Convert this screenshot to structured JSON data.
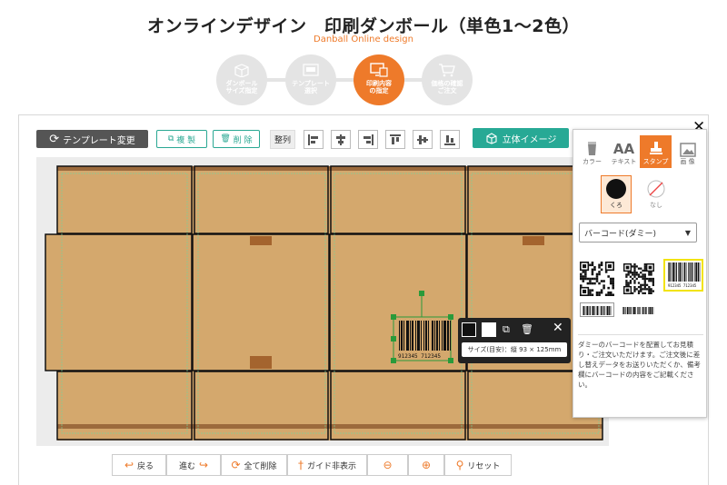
{
  "header": {
    "title": "オンラインデザイン　印刷ダンボール（単色1～2色）",
    "subtitle": "Danball Online design"
  },
  "steps": [
    {
      "label1": "ダンボール",
      "label2": "サイズ指定"
    },
    {
      "label1": "テンプレート",
      "label2": "選択"
    },
    {
      "label1": "印刷内容",
      "label2": "の指定"
    },
    {
      "label1": "価格の確認",
      "label2": "ご注文"
    }
  ],
  "toolbar": {
    "template_change": "テンプレート変更",
    "duplicate": "複 製",
    "delete": "削 除",
    "align": "整列",
    "view_3d": "立体イメージ"
  },
  "panel": {
    "tabs": [
      "カラー",
      "テキスト",
      "スタンプ",
      "画 像"
    ],
    "swatch_black": "くろ",
    "swatch_none": "なし",
    "select_value": "バーコード(ダミー)",
    "barcode_digits": "912345 712345",
    "description": "ダミーのバーコードを配置してお見積り・ご注文いただけます。ご注文後に差し替えデータをお送りいただくか、備考欄にバーコードの内容をご記載ください。"
  },
  "popup": {
    "size_text": "サイズ(目安)：縦 93 × 125mm"
  },
  "barcode_label": "912345 712345",
  "bottom": {
    "back": "戻る",
    "forward": "進む",
    "delete_all": "全て削除",
    "guide": "ガイド非表示",
    "zoom_out": "",
    "zoom_in": "",
    "reset": "リセット"
  },
  "colors": {
    "accent": "#ee7a2a",
    "teal": "#27a995",
    "box": "#d4a86d"
  }
}
